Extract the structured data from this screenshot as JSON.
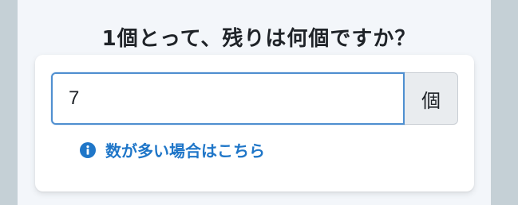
{
  "question": "1個とって、残りは何個ですか？",
  "answer": {
    "value": "7",
    "unit": "個"
  },
  "help": {
    "icon": "info-circle-icon",
    "label": "数が多い場合はこちら"
  },
  "colors": {
    "background": "#c5d0d6",
    "panel": "#f3f6fa",
    "accent": "#1f76c8",
    "input_border": "#4f8fd0"
  }
}
